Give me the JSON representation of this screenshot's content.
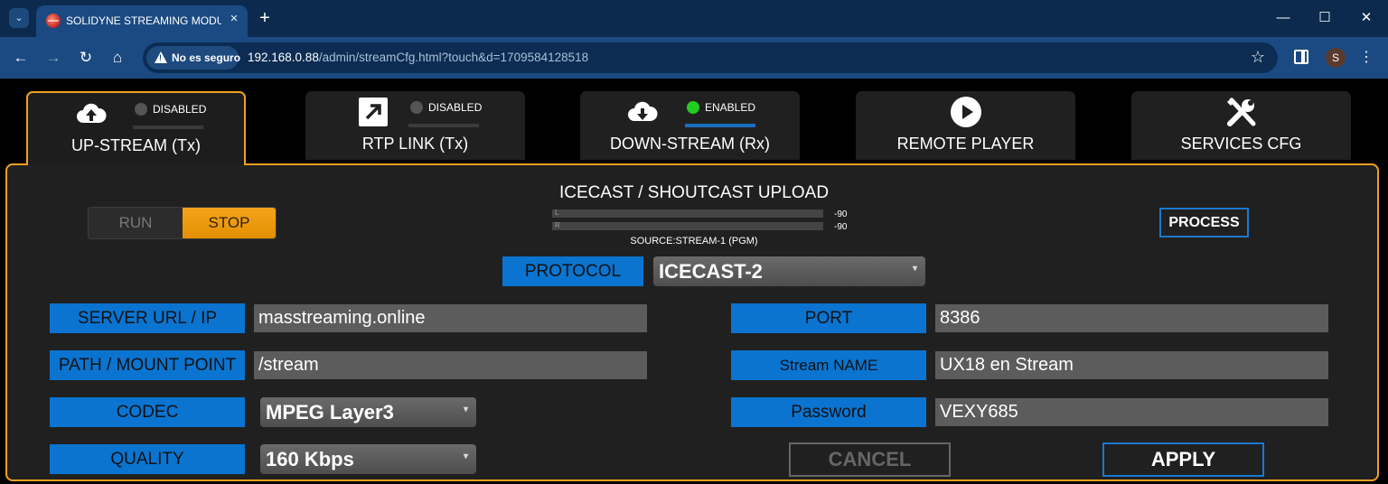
{
  "browser": {
    "tab_title": "SOLIDYNE STREAMING MODUL",
    "tab_close": "×",
    "new_tab": "+",
    "tab_list": "⌄",
    "window_controls": {
      "minimize": "—",
      "maximize": "☐",
      "close": "✕"
    },
    "security_label": "No es seguro",
    "url_host": "192.168.0.88",
    "url_path": "/admin/streamCfg.html?touch&d=1709584128518",
    "profile_initial": "S"
  },
  "nav": {
    "tabs": [
      {
        "label": "UP-STREAM (Tx)",
        "icon": "cloud-upload-icon",
        "status": "DISABLED",
        "status_color": "#555555",
        "active": true
      },
      {
        "label": "RTP LINK (Tx)",
        "icon": "arrow-up-right-icon",
        "status": "DISABLED",
        "status_color": "#555555",
        "active": false
      },
      {
        "label": "DOWN-STREAM (Rx)",
        "icon": "cloud-download-icon",
        "status": "ENABLED",
        "status_color": "#22cc22",
        "active": false
      },
      {
        "label": "REMOTE PLAYER",
        "icon": "play-icon",
        "active": false
      },
      {
        "label": "SERVICES CFG",
        "icon": "tools-icon",
        "active": false
      }
    ]
  },
  "panel": {
    "run_label": "RUN",
    "stop_label": "STOP",
    "title": "ICECAST / SHOUTCAST UPLOAD",
    "meter_left_label": "L",
    "meter_right_label": "R",
    "meter_left_db": "-90",
    "meter_right_db": "-90",
    "source": "SOURCE:STREAM-1 (PGM)",
    "process_label": "PROCESS",
    "protocol_label": "PROTOCOL",
    "protocol_value": "ICECAST-2",
    "server_label": "SERVER URL / IP",
    "server_value": "masstreaming.online",
    "port_label": "PORT",
    "port_value": "8386",
    "path_label": "PATH / MOUNT POINT",
    "path_value": "/stream",
    "stream_name_label": "Stream NAME",
    "stream_name_value": "UX18 en Stream",
    "codec_label": "CODEC",
    "codec_value": "MPEG Layer3",
    "password_label": "Password",
    "password_value": "VEXY685",
    "quality_label": "QUALITY",
    "quality_value": "160 Kbps",
    "cancel_label": "CANCEL",
    "apply_label": "APPLY"
  },
  "colors": {
    "accent": "#f0a020",
    "label_blue": "#0a74d0",
    "enabled_green": "#22cc22"
  }
}
